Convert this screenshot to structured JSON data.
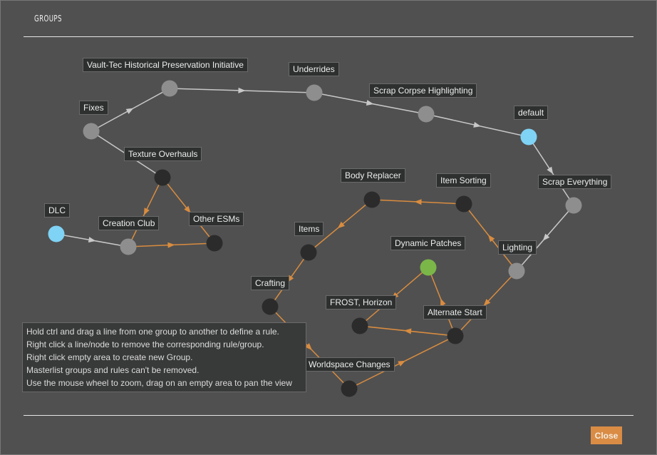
{
  "dialog": {
    "title": "GROUPS",
    "close_label": "Close"
  },
  "colors": {
    "master_node": "#8e8e8e",
    "user_node": "#2b2b2b",
    "default_node": "#7fd3f5",
    "selected_node": "#7ab648",
    "master_edge": "#c8c8c8",
    "user_edge": "#d98c3f",
    "accent": "#da8c45"
  },
  "groups": [
    {
      "id": "fixes",
      "label": "Fixes",
      "type": "master"
    },
    {
      "id": "vaulttec",
      "label": "Vault-Tec Historical Preservation Initiative",
      "type": "master"
    },
    {
      "id": "underrides",
      "label": "Underrides",
      "type": "master"
    },
    {
      "id": "scrapcorpse",
      "label": "Scrap Corpse Highlighting",
      "type": "master"
    },
    {
      "id": "default",
      "label": "default",
      "type": "default"
    },
    {
      "id": "scrapeverything",
      "label": "Scrap Everything",
      "type": "master"
    },
    {
      "id": "lighting",
      "label": "Lighting",
      "type": "master"
    },
    {
      "id": "texture",
      "label": "Texture Overhauls",
      "type": "user"
    },
    {
      "id": "creationclub",
      "label": "Creation Club",
      "type": "master"
    },
    {
      "id": "otheresms",
      "label": "Other ESMs",
      "type": "user"
    },
    {
      "id": "dlc",
      "label": "DLC",
      "type": "default"
    },
    {
      "id": "bodyreplacer",
      "label": "Body Replacer",
      "type": "user"
    },
    {
      "id": "itemsorting",
      "label": "Item Sorting",
      "type": "user"
    },
    {
      "id": "items",
      "label": "Items",
      "type": "user"
    },
    {
      "id": "crafting",
      "label": "Crafting",
      "type": "user"
    },
    {
      "id": "dynamic",
      "label": "Dynamic Patches",
      "type": "selected"
    },
    {
      "id": "frost",
      "label": "FROST, Horizon",
      "type": "user"
    },
    {
      "id": "alternate",
      "label": "Alternate Start",
      "type": "user"
    },
    {
      "id": "worldspace",
      "label": "Worldspace Changes",
      "type": "user"
    }
  ],
  "rules": [
    {
      "from": "fixes",
      "to": "vaulttec",
      "type": "master",
      "arrow": true
    },
    {
      "from": "vaulttec",
      "to": "underrides",
      "type": "master",
      "arrow": true
    },
    {
      "from": "underrides",
      "to": "scrapcorpse",
      "type": "master",
      "arrow": true
    },
    {
      "from": "scrapcorpse",
      "to": "default",
      "type": "master",
      "arrow": true
    },
    {
      "from": "default",
      "to": "scrapeverything",
      "type": "master",
      "arrow": true
    },
    {
      "from": "scrapeverything",
      "to": "lighting",
      "type": "master",
      "arrow": true
    },
    {
      "from": "fixes",
      "to": "texture",
      "type": "master",
      "arrow": false
    },
    {
      "from": "dlc",
      "to": "creationclub",
      "type": "master",
      "arrow": true
    },
    {
      "from": "texture",
      "to": "creationclub",
      "type": "user",
      "arrow": true
    },
    {
      "from": "texture",
      "to": "otheresms",
      "type": "user",
      "arrow": true
    },
    {
      "from": "creationclub",
      "to": "otheresms",
      "type": "user",
      "arrow": true
    },
    {
      "from": "itemsorting",
      "to": "bodyreplacer",
      "type": "user",
      "arrow": true
    },
    {
      "from": "bodyreplacer",
      "to": "items",
      "type": "user",
      "arrow": true
    },
    {
      "from": "items",
      "to": "crafting",
      "type": "user",
      "arrow": true
    },
    {
      "from": "crafting",
      "to": "worldspace",
      "type": "user",
      "arrow": true
    },
    {
      "from": "worldspace",
      "to": "alternate",
      "type": "user",
      "arrow": true
    },
    {
      "from": "alternate",
      "to": "frost",
      "type": "user",
      "arrow": true
    },
    {
      "from": "dynamic",
      "to": "frost",
      "type": "user",
      "arrow": true
    },
    {
      "from": "alternate",
      "to": "dynamic",
      "type": "user",
      "arrow": true
    },
    {
      "from": "lighting",
      "to": "itemsorting",
      "type": "user",
      "arrow": true
    },
    {
      "from": "lighting",
      "to": "alternate",
      "type": "user",
      "arrow": true
    }
  ],
  "help": {
    "lines": [
      "Hold ctrl and drag a line from one group to another to define a rule.",
      "Right click a line/node to remove the corresponding rule/group.",
      "Right click empty area to create new Group.",
      "Masterlist groups and rules can't be removed.",
      "Use the mouse wheel to zoom, drag on an empty area to pan the view"
    ]
  }
}
